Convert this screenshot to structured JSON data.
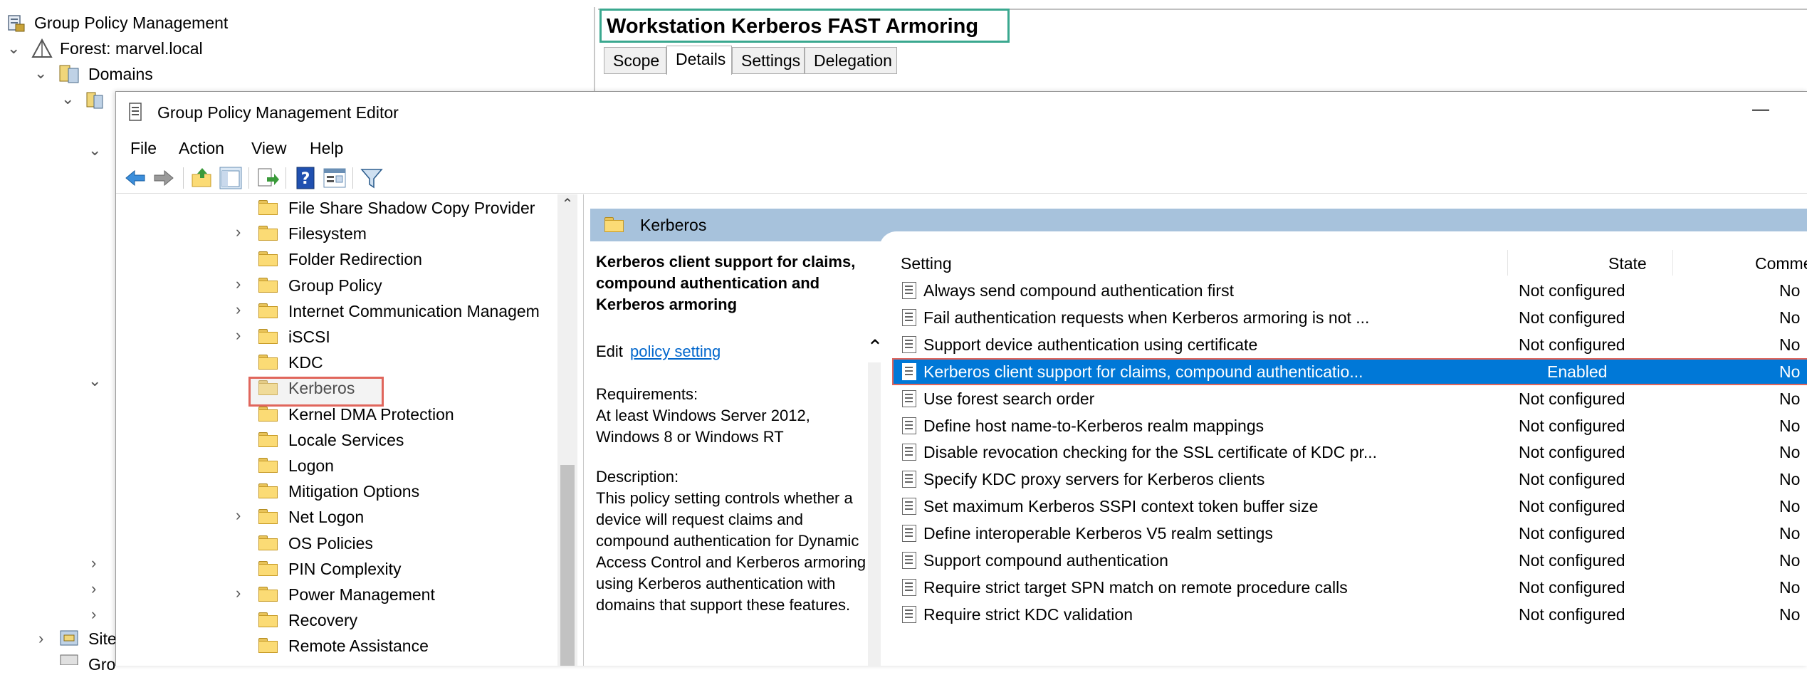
{
  "gpm": {
    "title": "Group Policy Management",
    "tree": [
      {
        "label": "Forest: marvel.local"
      },
      {
        "label": "Domains"
      },
      {
        "label": "Site"
      },
      {
        "label": "Gro"
      }
    ],
    "gpo_title": "Workstation Kerberos FAST Armoring",
    "tabs": [
      "Scope",
      "Details",
      "Settings",
      "Delegation"
    ],
    "active_tab": "Details"
  },
  "editor": {
    "title": "Group Policy Management Editor",
    "minimize": "—",
    "menu": [
      "File",
      "Action",
      "View",
      "Help"
    ],
    "toolbar_icons": [
      "back-arrow-icon",
      "forward-arrow-icon",
      "up-folder-icon",
      "show-hide-tree-icon",
      "export-list-icon",
      "help-icon",
      "properties-icon",
      "filter-icon"
    ],
    "tree_items": [
      {
        "label": "File Share Shadow Copy Provider",
        "expand": false
      },
      {
        "label": "Filesystem",
        "expand": true
      },
      {
        "label": "Folder Redirection",
        "expand": false
      },
      {
        "label": "Group Policy",
        "expand": true
      },
      {
        "label": "Internet Communication Managem",
        "expand": true
      },
      {
        "label": "iSCSI",
        "expand": true
      },
      {
        "label": "KDC",
        "expand": false
      },
      {
        "label": "Kerberos",
        "expand": false,
        "selected": true
      },
      {
        "label": "Kernel DMA Protection",
        "expand": false
      },
      {
        "label": "Locale Services",
        "expand": false
      },
      {
        "label": "Logon",
        "expand": false
      },
      {
        "label": "Mitigation Options",
        "expand": false
      },
      {
        "label": "Net Logon",
        "expand": true
      },
      {
        "label": "OS Policies",
        "expand": false
      },
      {
        "label": "PIN Complexity",
        "expand": false
      },
      {
        "label": "Power Management",
        "expand": true
      },
      {
        "label": "Recovery",
        "expand": false
      },
      {
        "label": "Remote Assistance",
        "expand": false
      }
    ],
    "folder_header": "Kerberos",
    "desc": {
      "title": "Kerberos client support for claims, compound authentication and Kerberos armoring",
      "edit_prefix": "Edit",
      "edit_link": "policy setting",
      "requirements_label": "Requirements:",
      "requirements": "At least Windows Server 2012, Windows 8 or Windows RT",
      "description_label": "Description:",
      "description": "This policy setting controls whether a device will request claims and compound authentication for Dynamic Access Control and Kerberos armoring using Kerberos authentication with domains that support these features."
    },
    "columns": [
      "Setting",
      "State",
      "Comment"
    ],
    "rows": [
      {
        "setting": "Always send compound authentication first",
        "state": "Not configured",
        "comment": "No"
      },
      {
        "setting": "Fail authentication requests when Kerberos armoring is not ...",
        "state": "Not configured",
        "comment": "No"
      },
      {
        "setting": "Support device authentication using certificate",
        "state": "Not configured",
        "comment": "No"
      },
      {
        "setting": "Kerberos client support for claims, compound authenticatio...",
        "state": "Enabled",
        "comment": "No",
        "selected": true
      },
      {
        "setting": "Use forest search order",
        "state": "Not configured",
        "comment": "No"
      },
      {
        "setting": "Define host name-to-Kerberos realm mappings",
        "state": "Not configured",
        "comment": "No"
      },
      {
        "setting": "Disable revocation checking for the SSL certificate of KDC pr...",
        "state": "Not configured",
        "comment": "No"
      },
      {
        "setting": "Specify KDC proxy servers for Kerberos clients",
        "state": "Not configured",
        "comment": "No"
      },
      {
        "setting": "Set maximum Kerberos SSPI context token buffer size",
        "state": "Not configured",
        "comment": "No"
      },
      {
        "setting": "Define interoperable Kerberos V5 realm settings",
        "state": "Not configured",
        "comment": "No"
      },
      {
        "setting": "Support compound authentication",
        "state": "Not configured",
        "comment": "No"
      },
      {
        "setting": "Require strict target SPN match on remote procedure calls",
        "state": "Not configured",
        "comment": "No"
      },
      {
        "setting": "Require strict KDC validation",
        "state": "Not configured",
        "comment": "No"
      }
    ],
    "colors": {
      "selection": "#0078d7",
      "header_bar": "#a7c2dc",
      "highlight_box": "#e0665c",
      "title_box": "#3aa88f",
      "link": "#0066cc"
    }
  }
}
